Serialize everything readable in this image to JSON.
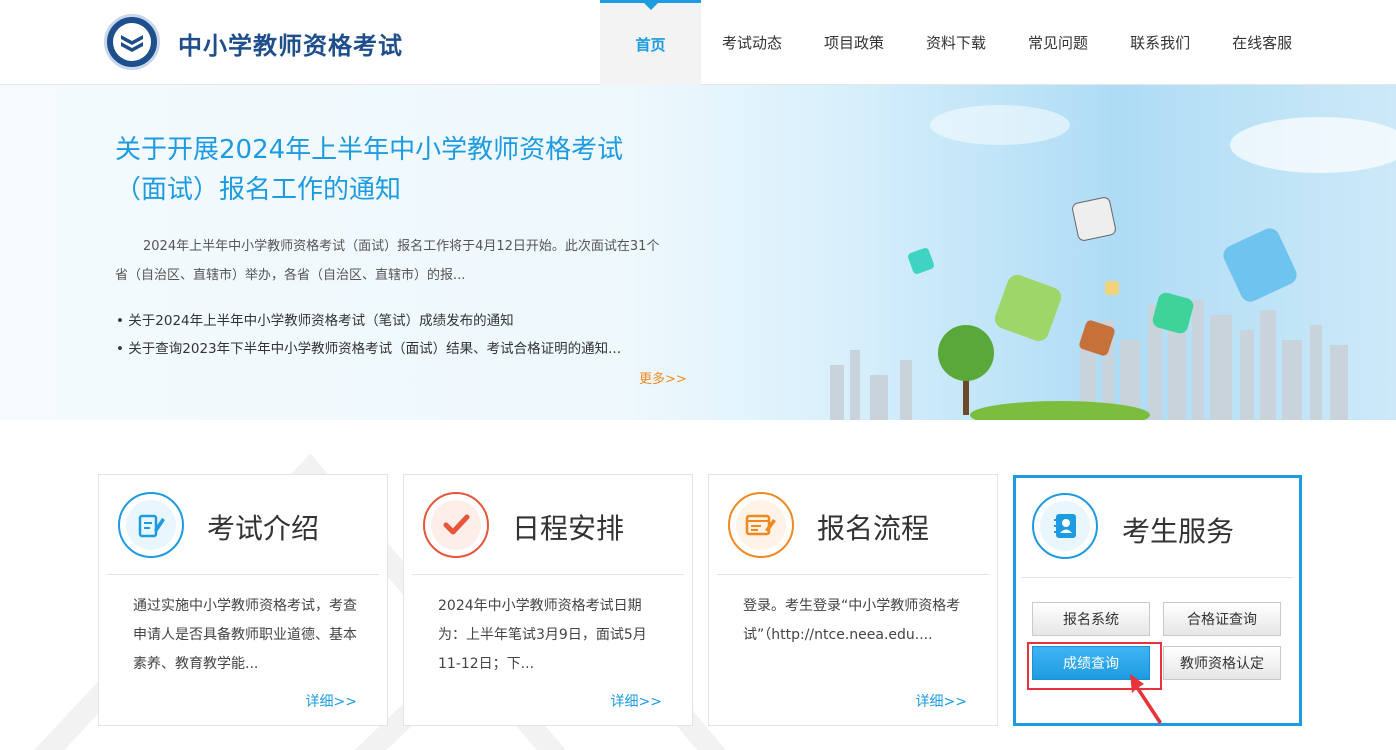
{
  "header": {
    "logo_text": "中小学教师资格考试",
    "nav": [
      "首页",
      "考试动态",
      "项目政策",
      "资料下载",
      "常见问题",
      "联系我们",
      "在线客服"
    ]
  },
  "banner": {
    "title": "关于开展2024年上半年中小学教师资格考试（面试）报名工作的通知",
    "summary": "2024年上半年中小学教师资格考试（面试）报名工作将于4月12日开始。此次面试在31个省（自治区、直辖市）举办，各省（自治区、直辖市）的报...",
    "links": [
      "关于2024年上半年中小学教师资格考试（笔试）成绩发布的通知",
      "关于查询2023年下半年中小学教师资格考试（面试）结果、考试合格证明的通知..."
    ],
    "more": "更多>>"
  },
  "cards": [
    {
      "title": "考试介绍",
      "body": "通过实施中小学教师资格考试，考查申请人是否具备教师职业道德、基本素养、教育教学能...",
      "more": "详细>>",
      "icon": "document-edit-icon",
      "color": "#1d9be0"
    },
    {
      "title": "日程安排",
      "body": "2024年中小学教师资格考试日期为：上半年笔试3月9日，面试5月11-12日；下...",
      "more": "详细>>",
      "icon": "checkmark-icon",
      "color": "#e8553b"
    },
    {
      "title": "报名流程",
      "body": "登录。考生登录“中小学教师资格考试”（http://ntce.neea.edu....",
      "more": "详细>>",
      "icon": "form-pen-icon",
      "color": "#f08a1e"
    }
  ],
  "service": {
    "title": "考生服务",
    "icon": "contact-book-icon",
    "buttons": [
      "报名系统",
      "合格证查询",
      "成绩查询",
      "教师资格认定"
    ]
  }
}
